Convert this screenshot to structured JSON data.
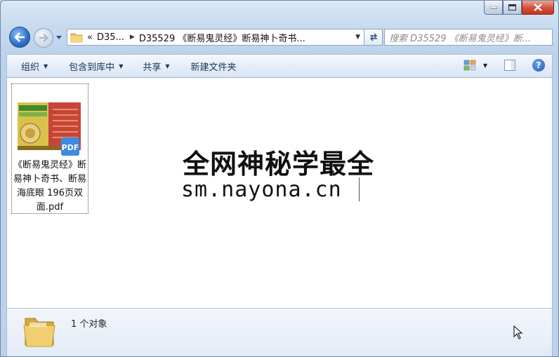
{
  "address_bar": {
    "overflow_chevron": "«",
    "crumbs": [
      "D35...",
      "D35529 《断易鬼灵经》断易神卜奇书..."
    ]
  },
  "search": {
    "placeholder": "搜索 D35529 《断易鬼灵经》断..."
  },
  "toolbar": {
    "organize": "组织",
    "include_in_library": "包含到库中",
    "share": "共享",
    "new_folder": "新建文件夹"
  },
  "file": {
    "name": "《断易鬼灵经》断易神卜奇书、断易海底眼 196页双面.pdf",
    "type_badge": "PDF"
  },
  "watermark": {
    "line1": "全网神秘学最全",
    "line2": "sm.nayona.cn"
  },
  "status": {
    "item_count": "1 个对象"
  },
  "colors": {
    "accent": "#2a6fc9",
    "close": "#c2361e",
    "pdf_badge": "#3c8be0"
  }
}
